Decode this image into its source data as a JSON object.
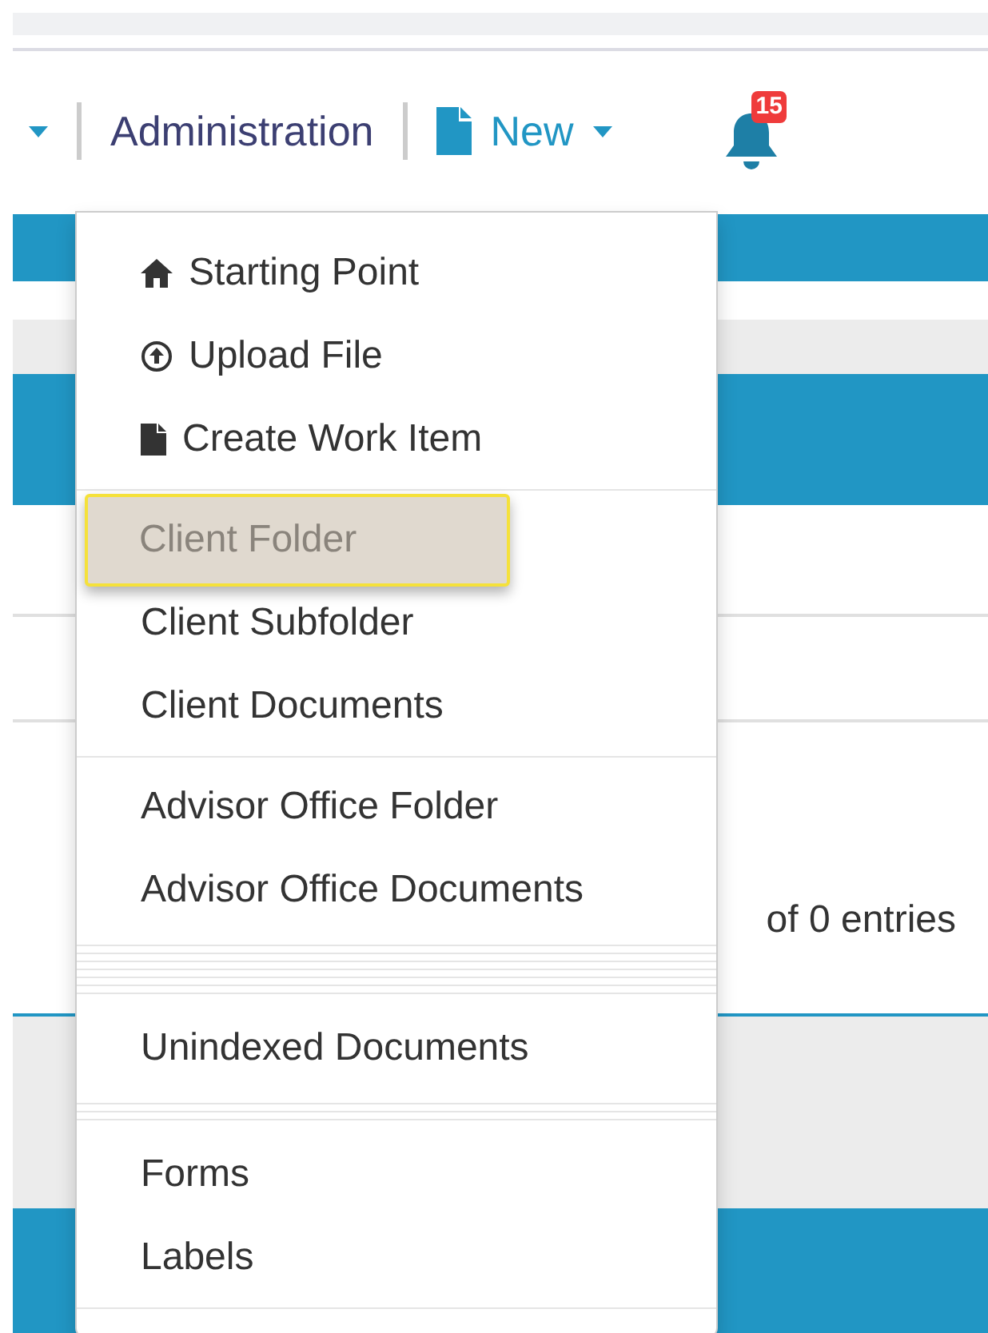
{
  "nav": {
    "administration": "Administration",
    "new": "New",
    "notification_count": "15"
  },
  "background": {
    "entries_text": "of 0 entries"
  },
  "menu": [
    {
      "kind": "home-item",
      "label": "Starting Point",
      "selected": false
    },
    {
      "kind": "upload-item",
      "label": "Upload File",
      "selected": false
    },
    {
      "kind": "file-item",
      "label": "Create Work Item",
      "selected": false
    },
    {
      "kind": "divider"
    },
    {
      "kind": "item",
      "label": "Client Folder",
      "selected": true
    },
    {
      "kind": "item",
      "label": "Client Subfolder",
      "selected": false
    },
    {
      "kind": "item",
      "label": "Client Documents",
      "selected": false
    },
    {
      "kind": "divider"
    },
    {
      "kind": "item",
      "label": "Advisor Office Folder",
      "selected": false
    },
    {
      "kind": "item",
      "label": "Advisor Office Documents",
      "selected": false
    },
    {
      "kind": "stacked-divider"
    },
    {
      "kind": "item",
      "label": "Unindexed Documents",
      "selected": false
    },
    {
      "kind": "short-stacked-divider"
    },
    {
      "kind": "item",
      "label": "Forms",
      "selected": false
    },
    {
      "kind": "item",
      "label": "Labels",
      "selected": false
    },
    {
      "kind": "divider"
    }
  ]
}
